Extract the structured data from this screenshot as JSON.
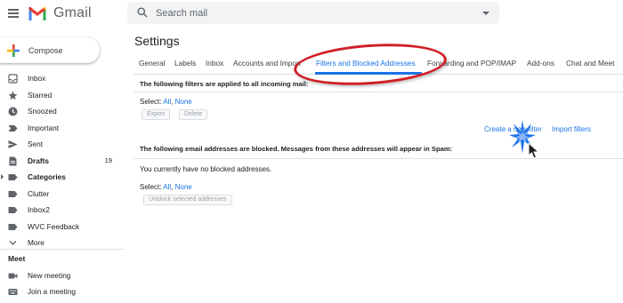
{
  "header": {
    "app_name": "Gmail",
    "search_placeholder": "Search mail"
  },
  "colors": {
    "accent": "#1a73e8",
    "highlight_ring": "#d01f24",
    "gmail_red": "#ea4335"
  },
  "sidebar": {
    "compose_label": "Compose",
    "items": [
      {
        "label": "Inbox",
        "icon": "inbox-icon"
      },
      {
        "label": "Starred",
        "icon": "star-icon"
      },
      {
        "label": "Snoozed",
        "icon": "clock-icon"
      },
      {
        "label": "Important",
        "icon": "important-icon"
      },
      {
        "label": "Sent",
        "icon": "send-icon"
      },
      {
        "label": "Drafts",
        "icon": "draft-icon",
        "count": "19",
        "bold": true
      },
      {
        "label": "Categories",
        "icon": "label-icon",
        "bold": true
      },
      {
        "label": "Clutter",
        "icon": "label-icon"
      },
      {
        "label": "Inbox2",
        "icon": "label-icon"
      },
      {
        "label": "WVC Feedback",
        "icon": "label-icon"
      },
      {
        "label": "More",
        "icon": "chevron-down-icon"
      }
    ],
    "meet": {
      "title": "Meet",
      "new_meeting": "New meeting",
      "join_meeting": "Join a meeting"
    }
  },
  "settings": {
    "title": "Settings",
    "tabs": [
      "General",
      "Labels",
      "Inbox",
      "Accounts and Import",
      "Filters and Blocked Addresses",
      "Forwarding and POP/IMAP",
      "Add-ons",
      "Chat and Meet"
    ],
    "active_tab": "Filters and Blocked Addresses",
    "filters": {
      "heading": "The following filters are applied to all incoming mail:",
      "select_prefix": "Select:",
      "select_all": "All",
      "select_sep": ",",
      "select_none": "None",
      "export_label": "Export",
      "delete_label": "Delete",
      "create_filter": "Create a new filter",
      "import_filters": "Import filters"
    },
    "blocked": {
      "heading": "The following email addresses are blocked. Messages from these addresses will appear in Spam:",
      "empty_message": "You currently have no blocked addresses.",
      "select_prefix": "Select:",
      "select_all": "All",
      "select_sep": ",",
      "select_none": "None",
      "unblock_label": "Unblock selected addresses"
    }
  }
}
